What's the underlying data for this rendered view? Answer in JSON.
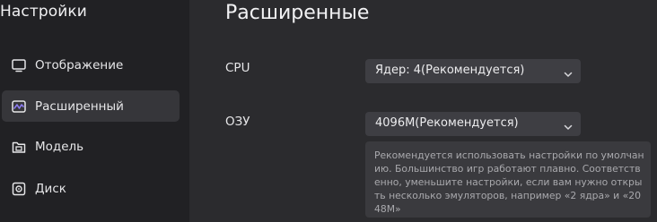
{
  "sidebar": {
    "title": "Настройки",
    "items": [
      {
        "label": "Отображение",
        "icon": "monitor-icon",
        "active": false
      },
      {
        "label": "Расширенный",
        "icon": "activity-icon",
        "active": true
      },
      {
        "label": "Модель",
        "icon": "folder-icon",
        "active": false
      },
      {
        "label": "Диск",
        "icon": "disk-icon",
        "active": false
      }
    ]
  },
  "main": {
    "title": "Расширенные",
    "cpu": {
      "label": "CPU",
      "value": "Ядер: 4(Рекомендуется)"
    },
    "ram": {
      "label": "ОЗУ",
      "value": "4096M(Рекомендуется)"
    },
    "hint": "Рекомендуется использовать настройки по умолчанию. Большинство игр работают плавно. Соответственно, уменьшите настройки, если вам нужно открыть несколько эмуляторов, например «2 ядра» и «2048M»"
  },
  "colors": {
    "sidebar_bg": "#212124",
    "main_bg": "#2b2b2e",
    "active_item_bg": "#36363a",
    "select_bg": "#3e3e43",
    "hint_bg": "#3a3a3e",
    "accent": "#8d7cf2"
  }
}
